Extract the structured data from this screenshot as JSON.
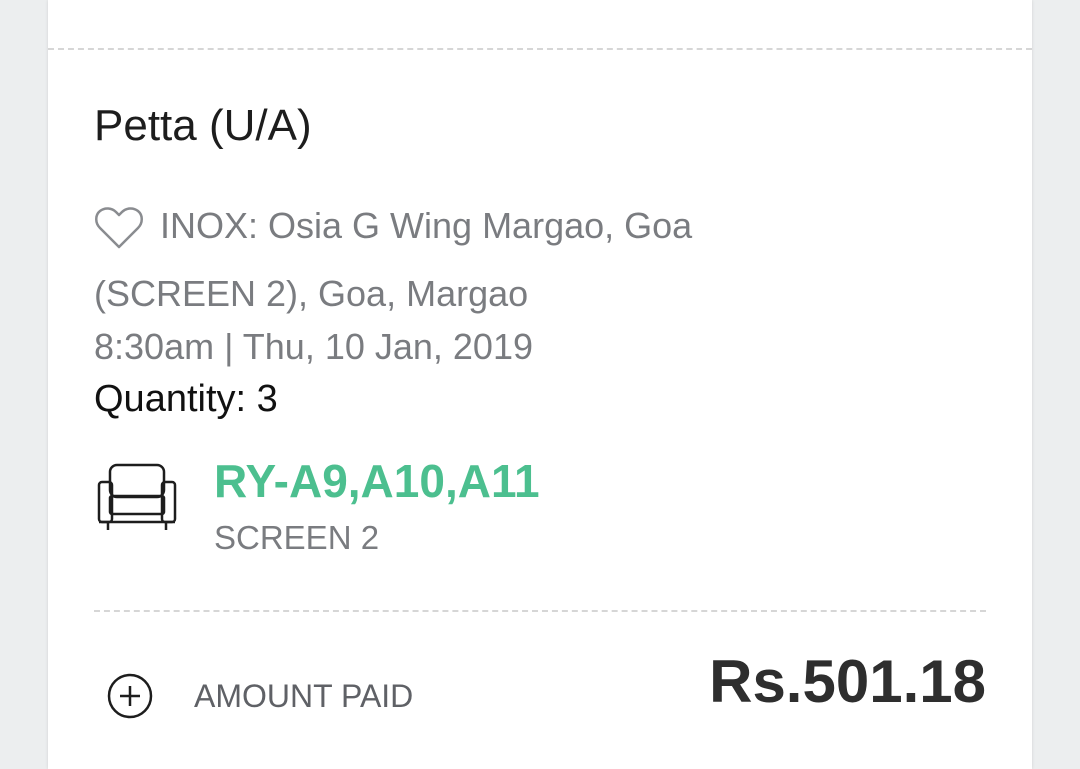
{
  "booking": {
    "movie_title": "Petta (U/A)",
    "venue_line1": "INOX: Osia G Wing Margao, Goa",
    "venue_line2": "(SCREEN 2), Goa, Margao",
    "showtime": "8:30am | Thu, 10 Jan, 2019",
    "quantity": "Quantity: 3",
    "seats": "RY-A9,A10,A11",
    "screen": "SCREEN 2"
  },
  "payment": {
    "label": "AMOUNT PAID",
    "amount": "Rs.501.18"
  },
  "icons": {
    "favorite": "heart-outline-icon",
    "seat": "armchair-icon",
    "expand": "plus-circle-icon"
  },
  "colors": {
    "seat_accent": "#4cbf8f",
    "secondary_text": "#7a7c80",
    "primary_text": "#1d1d1d",
    "background": "#eceeef"
  }
}
